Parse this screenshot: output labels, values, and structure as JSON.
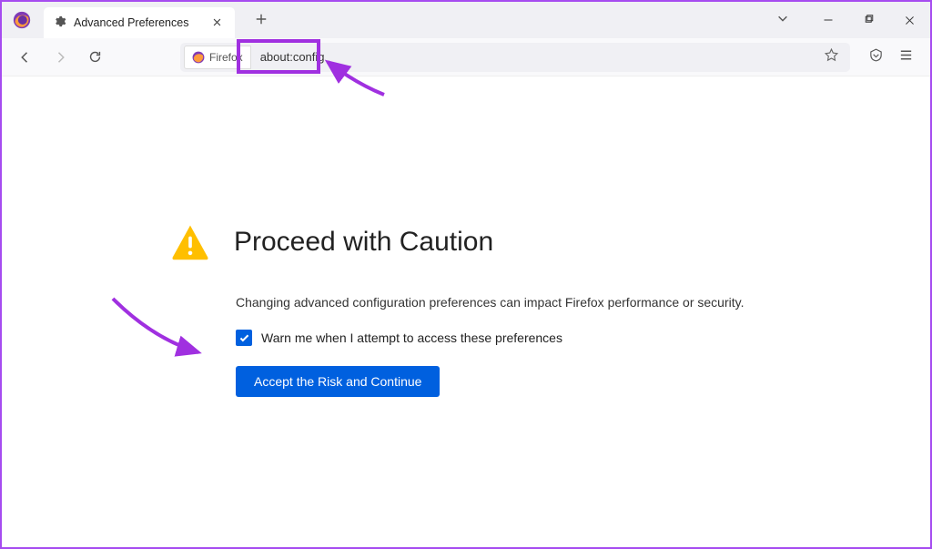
{
  "tab": {
    "title": "Advanced Preferences"
  },
  "urlbar": {
    "prefix_label": "Firefox",
    "url": "about:config"
  },
  "warning": {
    "title": "Proceed with Caution",
    "body": "Changing advanced configuration preferences can impact Firefox performance or security.",
    "checkbox_label": "Warn me when I attempt to access these preferences",
    "button_label": "Accept the Risk and Continue"
  },
  "colors": {
    "accent": "#0060df",
    "annotation": "#a030e0",
    "warning_icon": "#ffbf00"
  }
}
